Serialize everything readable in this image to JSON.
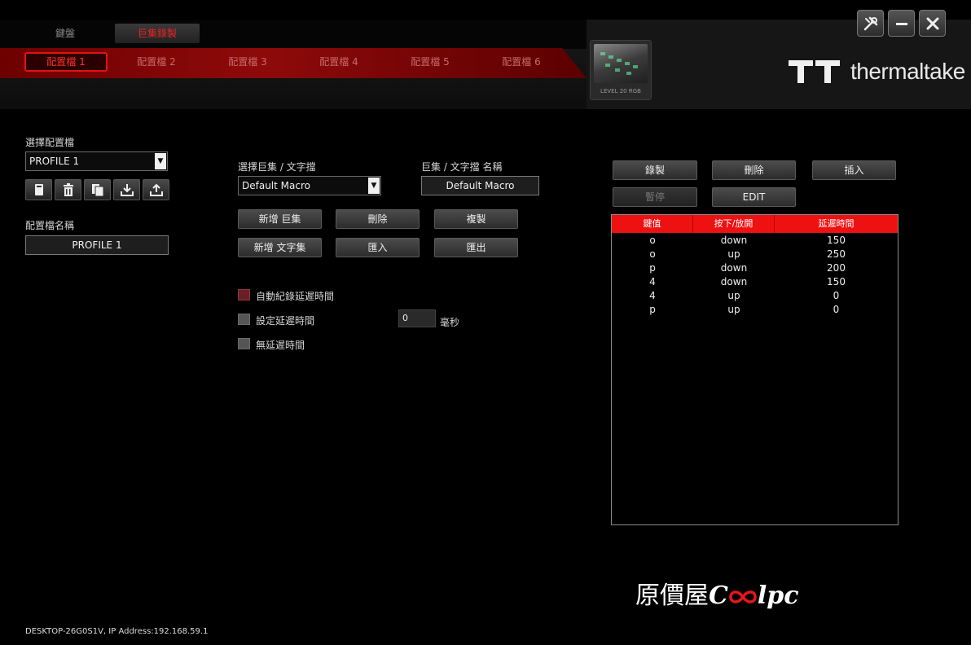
{
  "main_tabs": [
    {
      "label": "鍵盤"
    },
    {
      "label": "巨集錄製"
    }
  ],
  "profile_tabs": [
    {
      "label": "配置檔 1"
    },
    {
      "label": "配置檔 2"
    },
    {
      "label": "配置檔 3"
    },
    {
      "label": "配置檔 4"
    },
    {
      "label": "配置檔 5"
    },
    {
      "label": "配置檔 6"
    }
  ],
  "device": {
    "caption": "LEVEL 20 RGB"
  },
  "brand_logo": {
    "text": "thermaltake"
  },
  "window_buttons": {
    "settings": "settings-icon",
    "minimize": "minimize-icon",
    "close": "close-icon"
  },
  "profile": {
    "select_label": "選擇配置檔",
    "selected": "PROFILE 1",
    "name_label": "配置檔名稱",
    "name_value": "PROFILE 1",
    "icons": [
      "document-icon",
      "trash-icon",
      "copy-icon",
      "import-icon",
      "export-icon"
    ]
  },
  "macro": {
    "select_label": "選擇巨集 / 文字擋",
    "selected": "Default Macro",
    "name_label": "巨集 / 文字擋 名稱",
    "name_value": "Default Macro",
    "buttons": {
      "new_macro": "新增 巨集",
      "delete": "刪除",
      "duplicate": "複製",
      "new_text": "新增 文字集",
      "import": "匯入",
      "export": "匯出"
    }
  },
  "delay_options": {
    "auto_record": "自動紀錄延遲時間",
    "set_delay": "設定延遲時間",
    "no_delay": "無延遲時間",
    "delay_value": "0",
    "delay_unit": "毫秒",
    "auto_record_checked": true,
    "set_delay_checked": false,
    "no_delay_checked": false
  },
  "recorder": {
    "record": "錄製",
    "delete": "刪除",
    "insert": "插入",
    "pause": "暫停",
    "edit": "EDIT"
  },
  "events_table": {
    "headers": [
      "鍵值",
      "按下/放開",
      "延遲時間"
    ],
    "rows": [
      [
        "o",
        "down",
        "150"
      ],
      [
        "o",
        "up",
        "250"
      ],
      [
        "p",
        "down",
        "200"
      ],
      [
        "4",
        "down",
        "150"
      ],
      [
        "4",
        "up",
        "0"
      ],
      [
        "p",
        "up",
        "0"
      ]
    ]
  },
  "watermark": {
    "prefix": "原價屋",
    "suffix": "lpc"
  },
  "host_info": "DESKTOP-26G0S1V, IP Address:192.168.59.1",
  "colors": {
    "accent_red": "#ee1111",
    "tab_red": "#8e0a0a",
    "background": "#000000"
  }
}
